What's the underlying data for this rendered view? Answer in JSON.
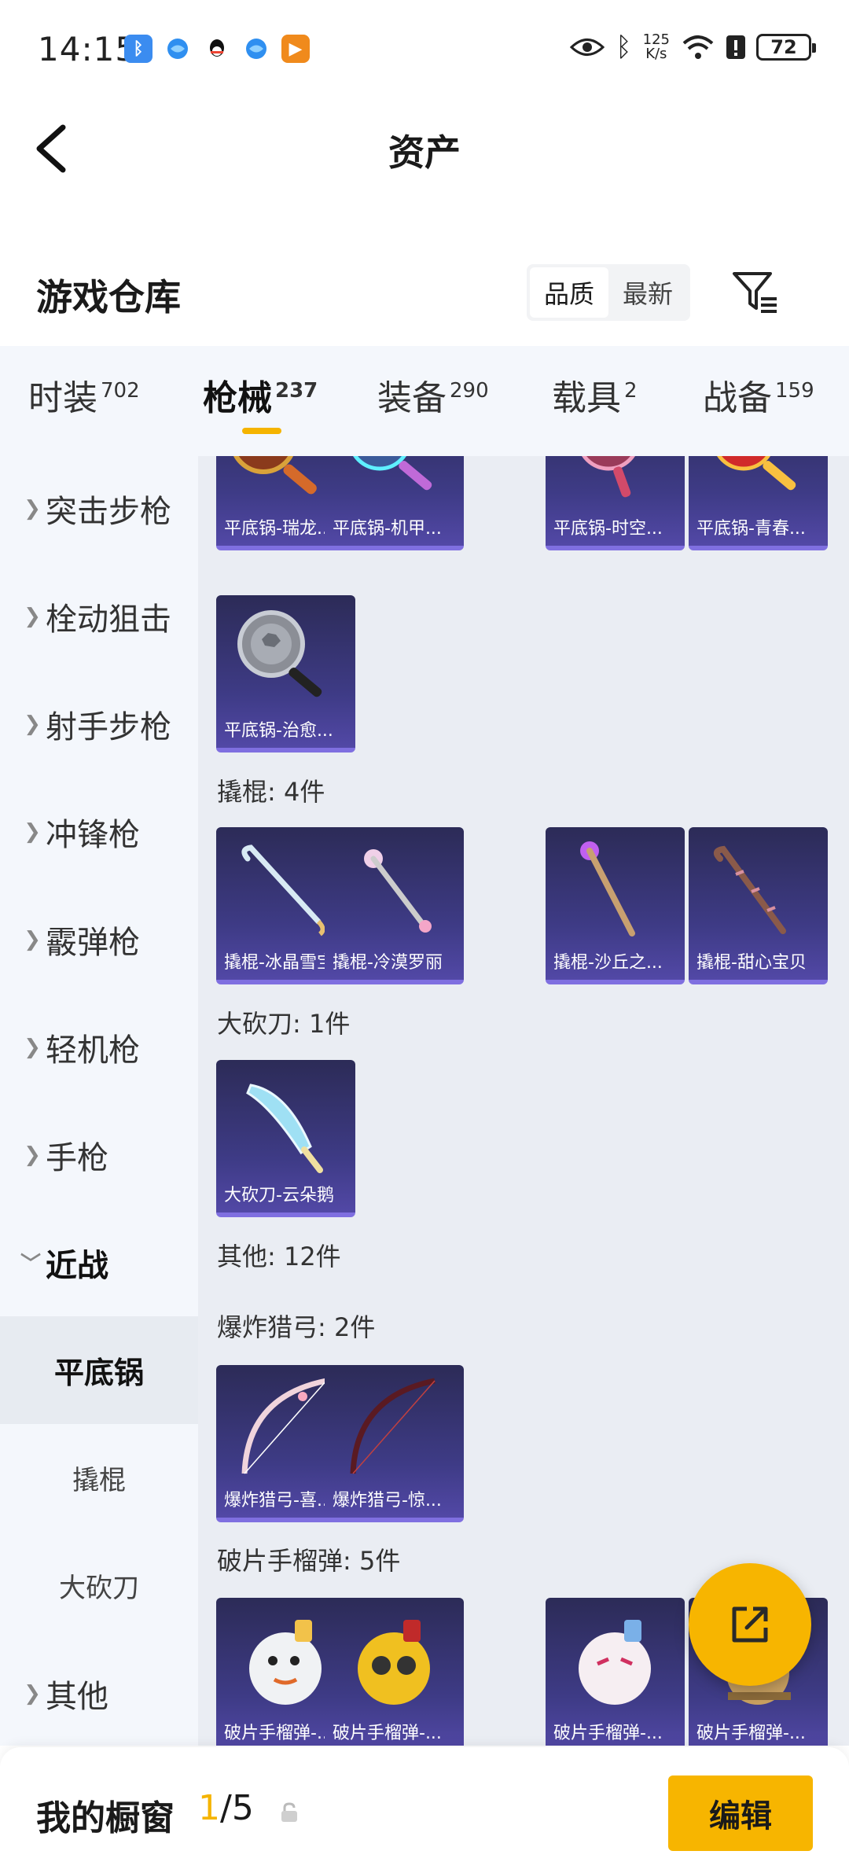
{
  "status_bar": {
    "time": "14:15",
    "net_speed_top": "125",
    "net_speed_bottom": "K/s",
    "battery": "72"
  },
  "header": {
    "title": "资产"
  },
  "section": {
    "title": "游戏仓库",
    "sort_quality": "品质",
    "sort_latest": "最新"
  },
  "tabs": [
    {
      "label": "时装",
      "count": "702"
    },
    {
      "label": "枪械",
      "count": "237"
    },
    {
      "label": "装备",
      "count": "290"
    },
    {
      "label": "载具",
      "count": "2"
    },
    {
      "label": "战备",
      "count": "159"
    }
  ],
  "sidebar": {
    "items": [
      {
        "label": "突击步枪"
      },
      {
        "label": "栓动狙击"
      },
      {
        "label": "射手步枪"
      },
      {
        "label": "冲锋枪"
      },
      {
        "label": "霰弹枪"
      },
      {
        "label": "轻机枪"
      },
      {
        "label": "手枪"
      },
      {
        "label": "近战"
      }
    ],
    "subitems": [
      {
        "label": "平底锅"
      },
      {
        "label": "撬棍"
      },
      {
        "label": "大砍刀"
      }
    ],
    "other": {
      "label": "其他"
    }
  },
  "content": {
    "pan_items": [
      {
        "name": "平底锅-瑞龙..."
      },
      {
        "name": "平底锅-机甲..."
      },
      {
        "name": "平底锅-时空..."
      },
      {
        "name": "平底锅-青春..."
      },
      {
        "name": "平底锅-治愈..."
      }
    ],
    "crowbar_title": "撬棍: 4件",
    "crowbar_items": [
      {
        "name": "撬棍-冰晶雪宝"
      },
      {
        "name": "撬棍-冷漠罗丽"
      },
      {
        "name": "撬棍-沙丘之..."
      },
      {
        "name": "撬棍-甜心宝贝"
      }
    ],
    "machete_title": "大砍刀: 1件",
    "machete_items": [
      {
        "name": "大砍刀-云朵鹅"
      }
    ],
    "other_title": "其他: 12件",
    "bow_title": "爆炸猎弓: 2件",
    "bow_items": [
      {
        "name": "爆炸猎弓-喜..."
      },
      {
        "name": "爆炸猎弓-惊..."
      }
    ],
    "grenade_title": "破片手榴弹: 5件",
    "grenade_items": [
      {
        "name": "破片手榴弹-..."
      },
      {
        "name": "破片手榴弹-..."
      },
      {
        "name": "破片手榴弹-..."
      },
      {
        "name": "破片手榴弹-..."
      }
    ]
  },
  "bottom_bar": {
    "label": "我的橱窗",
    "current": "1",
    "total": "/5",
    "edit_label": "编辑"
  },
  "colors": {
    "accent": "#f7b500",
    "card_top": "#2c2b57",
    "card_bottom": "#5248a6",
    "sidebar_bg": "#f4f7fc",
    "content_bg": "#eaedf3"
  }
}
